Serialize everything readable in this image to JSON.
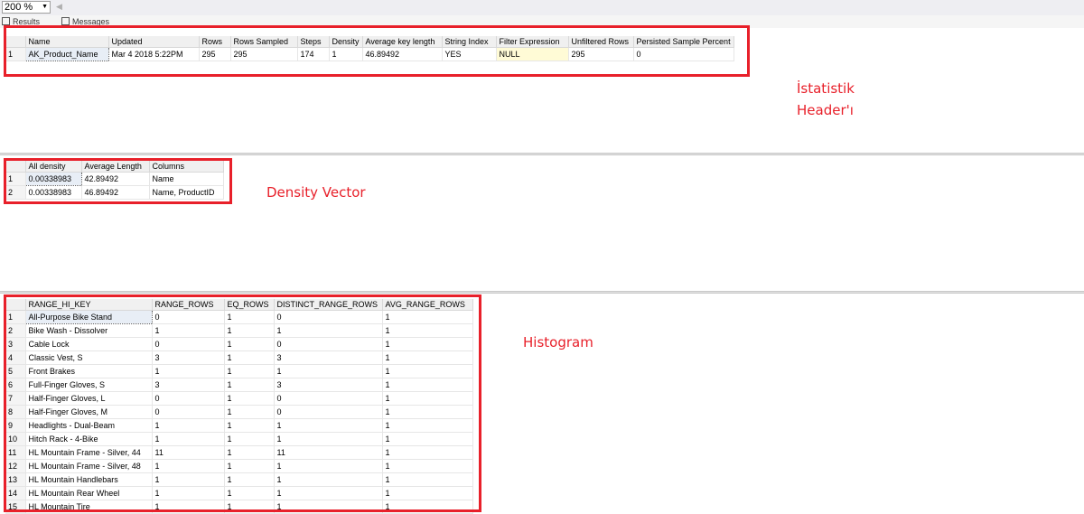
{
  "toolbar": {
    "zoom": "200 %"
  },
  "tabs": {
    "results": "Results",
    "messages": "Messages"
  },
  "header_grid": {
    "columns": [
      "Name",
      "Updated",
      "Rows",
      "Rows Sampled",
      "Steps",
      "Density",
      "Average key length",
      "String Index",
      "Filter Expression",
      "Unfiltered Rows",
      "Persisted Sample Percent"
    ],
    "rows": [
      [
        "1",
        "AK_Product_Name",
        "Mar  4 2018  5:22PM",
        "295",
        "295",
        "174",
        "1",
        "46.89492",
        "YES",
        "NULL",
        "295",
        "0"
      ]
    ]
  },
  "density_grid": {
    "columns": [
      "All density",
      "Average Length",
      "Columns"
    ],
    "rows": [
      [
        "1",
        "0.00338983",
        "42.89492",
        "Name"
      ],
      [
        "2",
        "0.00338983",
        "46.89492",
        "Name, ProductID"
      ]
    ]
  },
  "histogram_grid": {
    "columns": [
      "RANGE_HI_KEY",
      "RANGE_ROWS",
      "EQ_ROWS",
      "DISTINCT_RANGE_ROWS",
      "AVG_RANGE_ROWS"
    ],
    "rows": [
      [
        "1",
        "All-Purpose Bike Stand",
        "0",
        "1",
        "0",
        "1"
      ],
      [
        "2",
        "Bike Wash - Dissolver",
        "1",
        "1",
        "1",
        "1"
      ],
      [
        "3",
        "Cable Lock",
        "0",
        "1",
        "0",
        "1"
      ],
      [
        "4",
        "Classic Vest, S",
        "3",
        "1",
        "3",
        "1"
      ],
      [
        "5",
        "Front Brakes",
        "1",
        "1",
        "1",
        "1"
      ],
      [
        "6",
        "Full-Finger Gloves, S",
        "3",
        "1",
        "3",
        "1"
      ],
      [
        "7",
        "Half-Finger Gloves, L",
        "0",
        "1",
        "0",
        "1"
      ],
      [
        "8",
        "Half-Finger Gloves, M",
        "0",
        "1",
        "0",
        "1"
      ],
      [
        "9",
        "Headlights - Dual-Beam",
        "1",
        "1",
        "1",
        "1"
      ],
      [
        "10",
        "Hitch Rack - 4-Bike",
        "1",
        "1",
        "1",
        "1"
      ],
      [
        "11",
        "HL Mountain Frame - Silver, 44",
        "11",
        "1",
        "11",
        "1"
      ],
      [
        "12",
        "HL Mountain Frame - Silver, 48",
        "1",
        "1",
        "1",
        "1"
      ],
      [
        "13",
        "HL Mountain Handlebars",
        "1",
        "1",
        "1",
        "1"
      ],
      [
        "14",
        "HL Mountain Rear Wheel",
        "1",
        "1",
        "1",
        "1"
      ],
      [
        "15",
        "HL Mountain Tire",
        "1",
        "1",
        "1",
        "1"
      ]
    ]
  },
  "annotations": {
    "header_line1": "İstatistik",
    "header_line2": "Header'ı",
    "density": "Density Vector",
    "histogram": "Histogram"
  },
  "colors": {
    "highlight_red": "#e8202a"
  }
}
